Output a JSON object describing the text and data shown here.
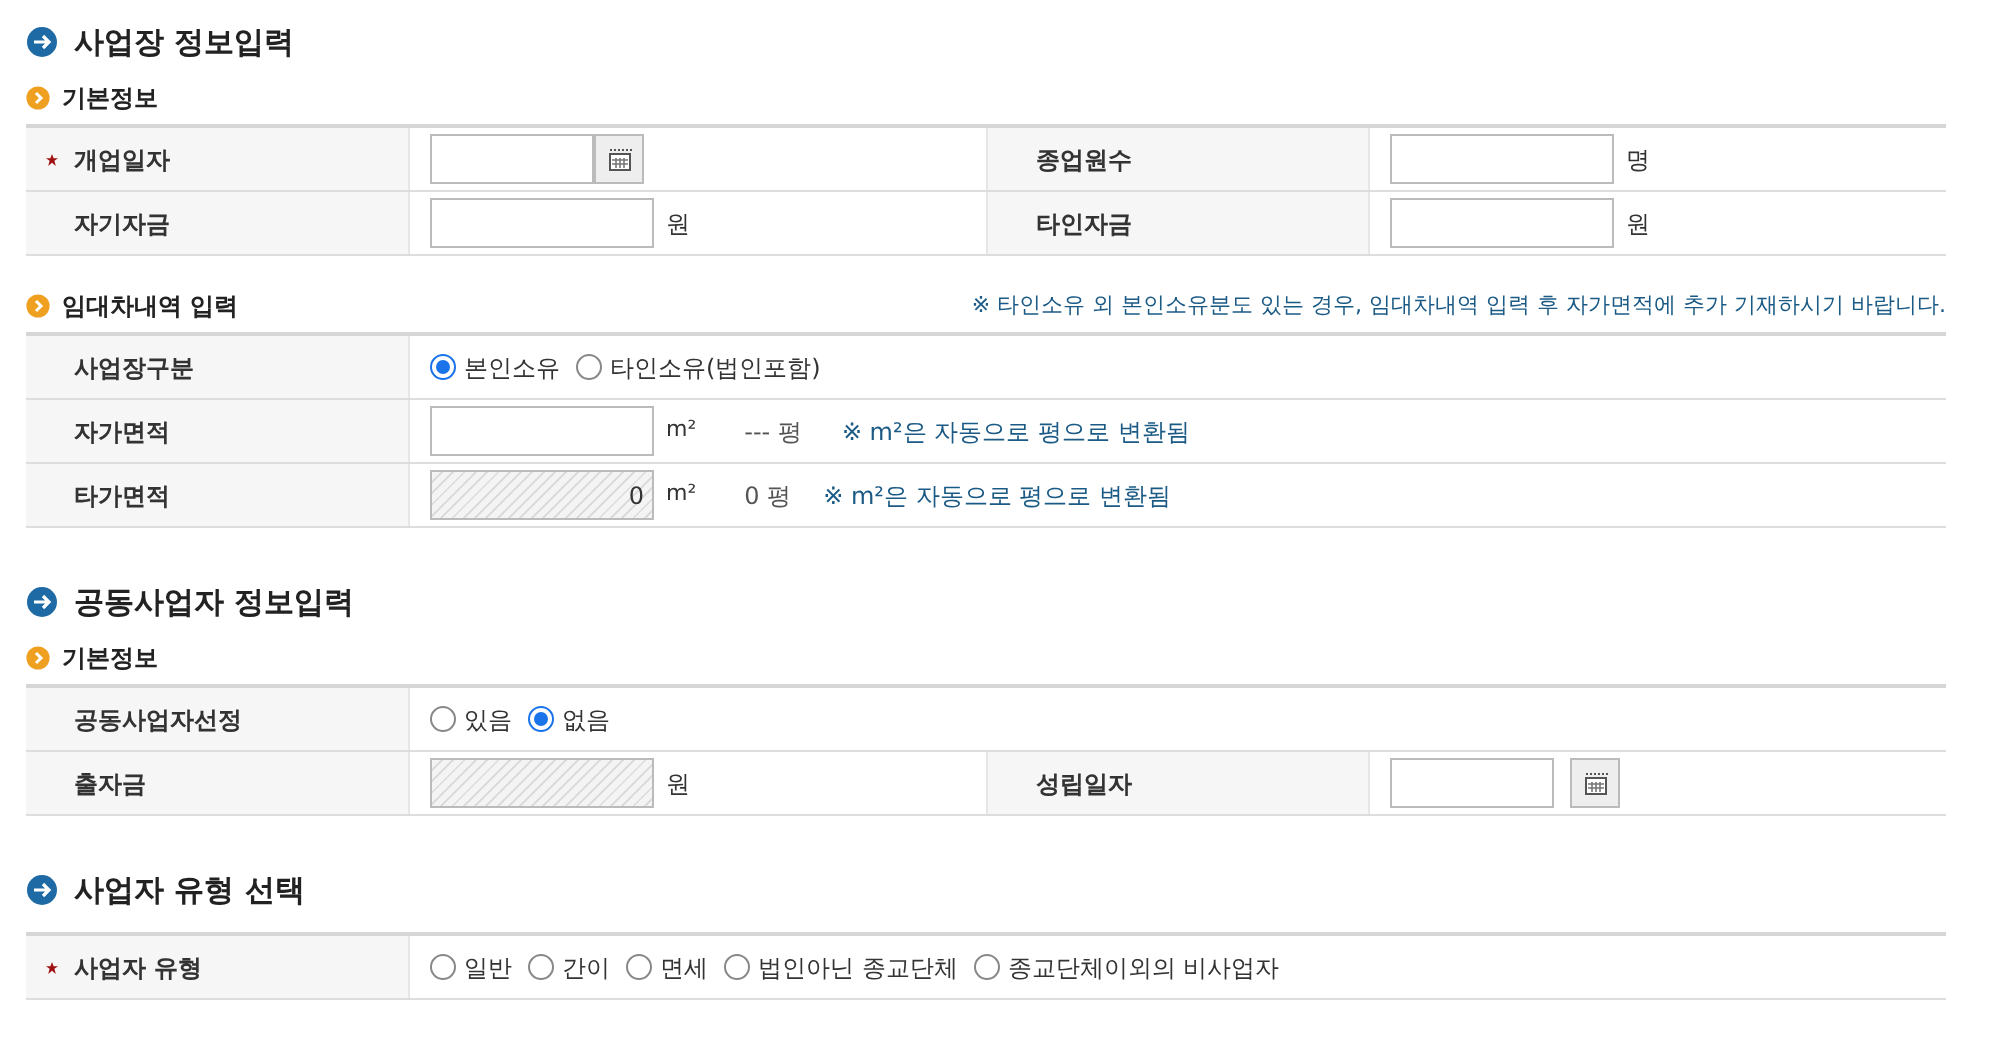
{
  "sections": [
    {
      "title": "사업장 정보입력",
      "groups": [
        {
          "subtitle": "기본정보",
          "rows": [
            {
              "cells": [
                {
                  "label": "개업일자",
                  "required": true,
                  "field": {
                    "kind": "date",
                    "attached": true
                  }
                },
                {
                  "label": "종업원수",
                  "required": false,
                  "field": {
                    "kind": "input",
                    "unit": "명",
                    "disabled": false
                  }
                }
              ]
            },
            {
              "cells": [
                {
                  "label": "자기자금",
                  "required": false,
                  "field": {
                    "kind": "input",
                    "unit": "원",
                    "disabled": false
                  }
                },
                {
                  "label": "타인자금",
                  "required": false,
                  "field": {
                    "kind": "input",
                    "unit": "원",
                    "disabled": false
                  }
                }
              ]
            }
          ]
        },
        {
          "subtitle": "임대차내역 입력",
          "note": "※ 타인소유 외 본인소유분도 있는 경우, 임대차내역 입력 후 자가면적에 추가 기재하시기 바랍니다.",
          "rows": [
            {
              "cells": [
                {
                  "label": "사업장구분",
                  "required": false,
                  "field": {
                    "kind": "radio",
                    "options": [
                      {
                        "label": "본인소유",
                        "selected": true
                      },
                      {
                        "label": "타인소유(법인포함)",
                        "selected": false
                      }
                    ]
                  }
                }
              ]
            },
            {
              "cells": [
                {
                  "label": "자가면적",
                  "required": false,
                  "field": {
                    "kind": "area",
                    "disabled": false,
                    "unit": "m²",
                    "pyeong": "--- 평",
                    "note": "※ m²은 자동으로 평으로 변환됨"
                  }
                }
              ]
            },
            {
              "cells": [
                {
                  "label": "타가면적",
                  "required": false,
                  "field": {
                    "kind": "area",
                    "disabled": true,
                    "value": "0",
                    "unit": "m²",
                    "pyeong": "0 평",
                    "note": "※ m²은 자동으로 평으로 변환됨"
                  }
                }
              ]
            }
          ]
        }
      ]
    },
    {
      "title": "공동사업자 정보입력",
      "groups": [
        {
          "subtitle": "기본정보",
          "rows": [
            {
              "cells": [
                {
                  "label": "공동사업자선정",
                  "required": false,
                  "field": {
                    "kind": "radio",
                    "options": [
                      {
                        "label": "있음",
                        "selected": false
                      },
                      {
                        "label": "없음",
                        "selected": true
                      }
                    ]
                  }
                }
              ]
            },
            {
              "cells": [
                {
                  "label": "출자금",
                  "required": false,
                  "field": {
                    "kind": "input",
                    "unit": "원",
                    "disabled": true
                  }
                },
                {
                  "label": "성립일자",
                  "required": false,
                  "field": {
                    "kind": "date",
                    "attached": false
                  }
                }
              ]
            }
          ]
        }
      ]
    },
    {
      "title": "사업자 유형 선택",
      "groups": [
        {
          "rows": [
            {
              "cells": [
                {
                  "label": "사업자 유형",
                  "required": true,
                  "field": {
                    "kind": "radio",
                    "options": [
                      {
                        "label": "일반",
                        "selected": false
                      },
                      {
                        "label": "간이",
                        "selected": false
                      },
                      {
                        "label": "면세",
                        "selected": false
                      },
                      {
                        "label": "법인아닌 종교단체",
                        "selected": false
                      },
                      {
                        "label": "종교단체이외의 비사업자",
                        "selected": false
                      }
                    ]
                  }
                }
              ]
            }
          ]
        }
      ]
    }
  ]
}
